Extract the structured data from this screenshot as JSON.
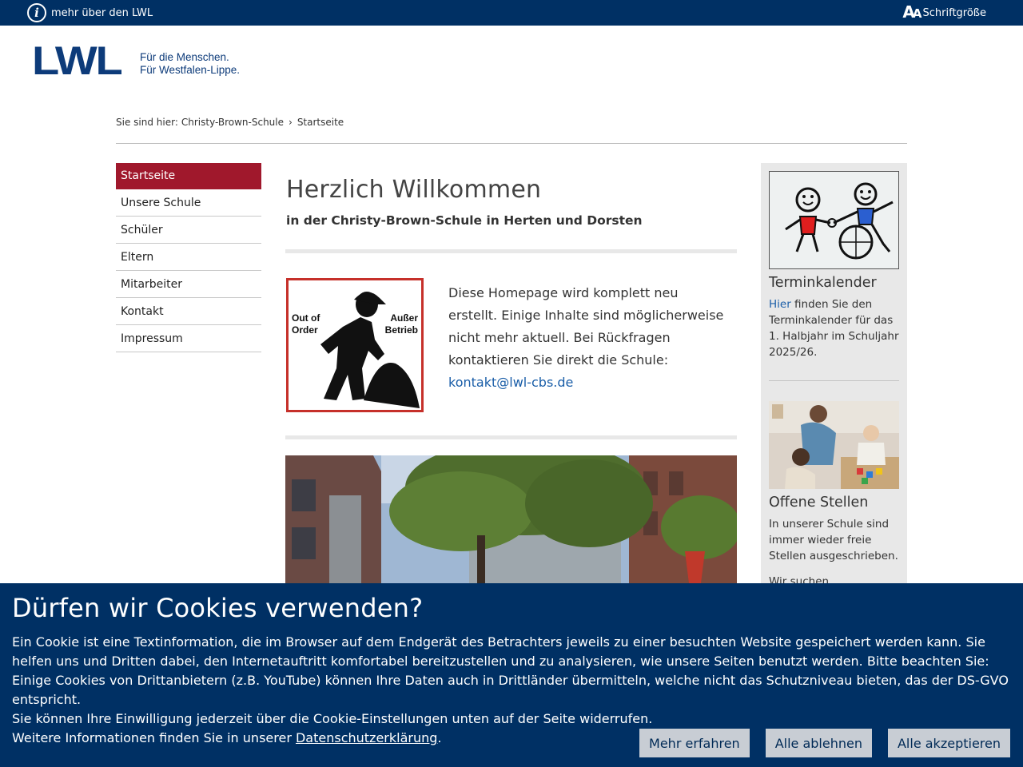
{
  "topbar": {
    "info_label": "mehr über den LWL",
    "fontsize_label": "Schriftgröße",
    "info_icon": "info-circle-icon",
    "fontsize_icon": "text-size-icon"
  },
  "logo": {
    "mark": "LWL",
    "line1": "Für die Menschen.",
    "line2": "Für Westfalen-Lippe."
  },
  "breadcrumb": {
    "prefix": "Sie sind hier:",
    "items": [
      "Christy-Brown-Schule",
      "Startseite"
    ],
    "separator": "›"
  },
  "nav": {
    "items": [
      {
        "label": "Startseite",
        "active": true
      },
      {
        "label": "Unsere Schule"
      },
      {
        "label": "Schüler"
      },
      {
        "label": "Eltern"
      },
      {
        "label": "Mitarbeiter"
      },
      {
        "label": "Kontakt"
      },
      {
        "label": "Impressum"
      }
    ]
  },
  "main": {
    "title": "Herzlich Willkommen",
    "subtitle": "in der Christy-Brown-Schule in Herten und Dorsten",
    "sign": {
      "left": "Out of\nOrder",
      "right": "Außer\nBetrieb"
    },
    "notice_text": "Diese Homepage wird komplett neu erstellt. Einige Inhalte sind möglicherweise nicht mehr aktuell. Bei Rückfragen kontaktieren Sie direkt die Schule: ",
    "notice_email": "kontakt@lwl-cbs.de"
  },
  "aside": {
    "teaser1": {
      "title": "Terminkalender",
      "link": "Hier",
      "text": " finden Sie den Terminkalender für das 1. Halbjahr im Schuljahr 2025/26."
    },
    "teaser2": {
      "title": "Offene Stellen",
      "text": "In unserer Schule sind immer wieder freie Stellen ausgeschrieben.",
      "more": "Wir suchen"
    }
  },
  "cookie": {
    "title": "Dürfen wir Cookies verwenden?",
    "text": "Ein Cookie ist eine Textinformation, die im Browser auf dem Endgerät des Betrachters jeweils zu einer besuchten Website gespeichert werden kann. Sie helfen uns und Dritten dabei, den Internetauftritt komfortabel bereitzustellen und zu analysieren, wie unsere Seiten benutzt werden. Bitte beachten Sie: Einige Cookies von Drittanbietern (z.B. YouTube) können Ihre Daten auch in Drittländer übermitteln, welche nicht das Schutzniveau bieten, das der DS-GVO entspricht.",
    "revoke": "Sie können Ihre Einwilligung jederzeit über die Cookie-Einstellungen unten auf der Seite widerrufen.",
    "more_prefix": "Weitere Informationen finden Sie in unserer ",
    "privacy_link": "Datenschutzerklärung",
    "more_suffix": ".",
    "buttons": {
      "more": "Mehr erfahren",
      "reject": "Alle ablehnen",
      "accept": "Alle akzeptieren"
    }
  },
  "colors": {
    "brand_blue": "#003064",
    "active_red": "#a0182c",
    "link_blue": "#1a5ea8"
  }
}
